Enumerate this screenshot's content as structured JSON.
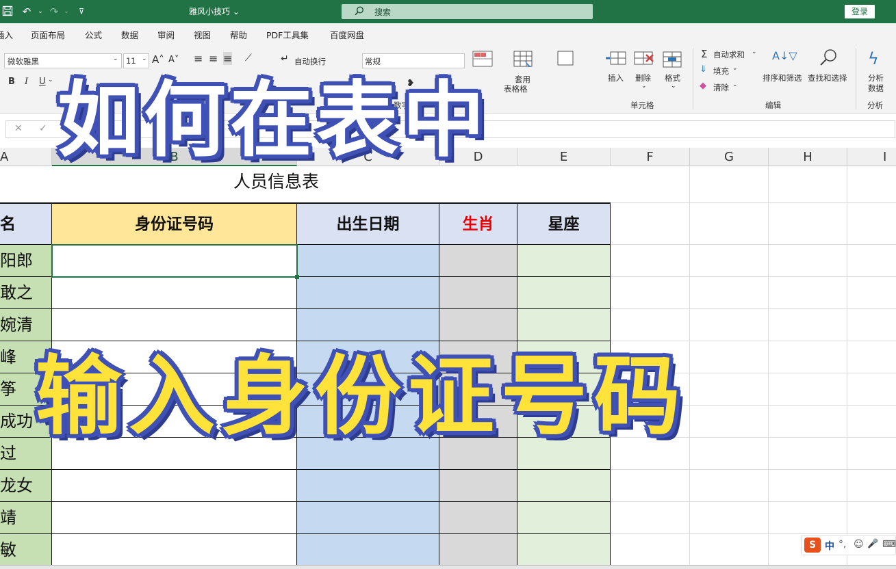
{
  "titlebar": {
    "title": "雅风小技巧 ⌄",
    "search_label": "搜索",
    "login": "登录",
    "quick_icons": [
      "save-icon",
      "undo-icon",
      "redo-icon",
      "customize-icon"
    ]
  },
  "menu": {
    "tabs": [
      "插入",
      "页面布局",
      "公式",
      "数据",
      "审阅",
      "视图",
      "帮助",
      "PDF工具集",
      "百度网盘"
    ]
  },
  "ribbon": {
    "font_name": "微软雅黑",
    "font_size": "11",
    "bold": "B",
    "italic": "I",
    "underline": "U",
    "wrap_text": "自动换行",
    "number_format": "常规",
    "number_group": "数字",
    "format_table_line1": "套用",
    "format_table_line2": "表格格",
    "insert": "插入",
    "delete": "删除",
    "format": "格式",
    "cells_group": "单元格",
    "autosum": "自动求和",
    "fill": "填充",
    "clear": "清除",
    "sort_filter": "排序和筛选",
    "find_select": "查找和选择",
    "editing_group": "编辑",
    "analyze_line1": "分析",
    "analyze_line2": "数据",
    "analysis_group": "分析"
  },
  "formula_bar": {
    "cancel": "✕",
    "confirm": "✓"
  },
  "columns": [
    "A",
    "B",
    "C",
    "D",
    "E",
    "F",
    "G",
    "H",
    "I"
  ],
  "sheet": {
    "title": "人员信息表",
    "headers": {
      "name": "名",
      "id": "身份证号码",
      "birth": "出生日期",
      "zodiac": "生肖",
      "constellation": "星座"
    },
    "header_colors": {
      "id_bg": "#ffe699",
      "zodiac_text": "#e60000",
      "other_bg": "#d9e1f2"
    },
    "names": [
      "阳郎",
      "敢之",
      "婉清",
      "峰",
      "筝",
      "成功",
      "过",
      "龙女",
      "靖",
      "敏"
    ],
    "column_fills": {
      "name": "#c6e0b4",
      "birth": "#c5d9f0",
      "zodiac": "#d9d9d9",
      "constellation": "#e2efda"
    }
  },
  "overlay": {
    "line1": "如何在表中",
    "line2": "输入身份证号码"
  },
  "ime": {
    "logo": "S",
    "mode": "中",
    "punct": "°,",
    "emoji": "☺",
    "mic": "🎤",
    "keyboard": "⌨"
  }
}
